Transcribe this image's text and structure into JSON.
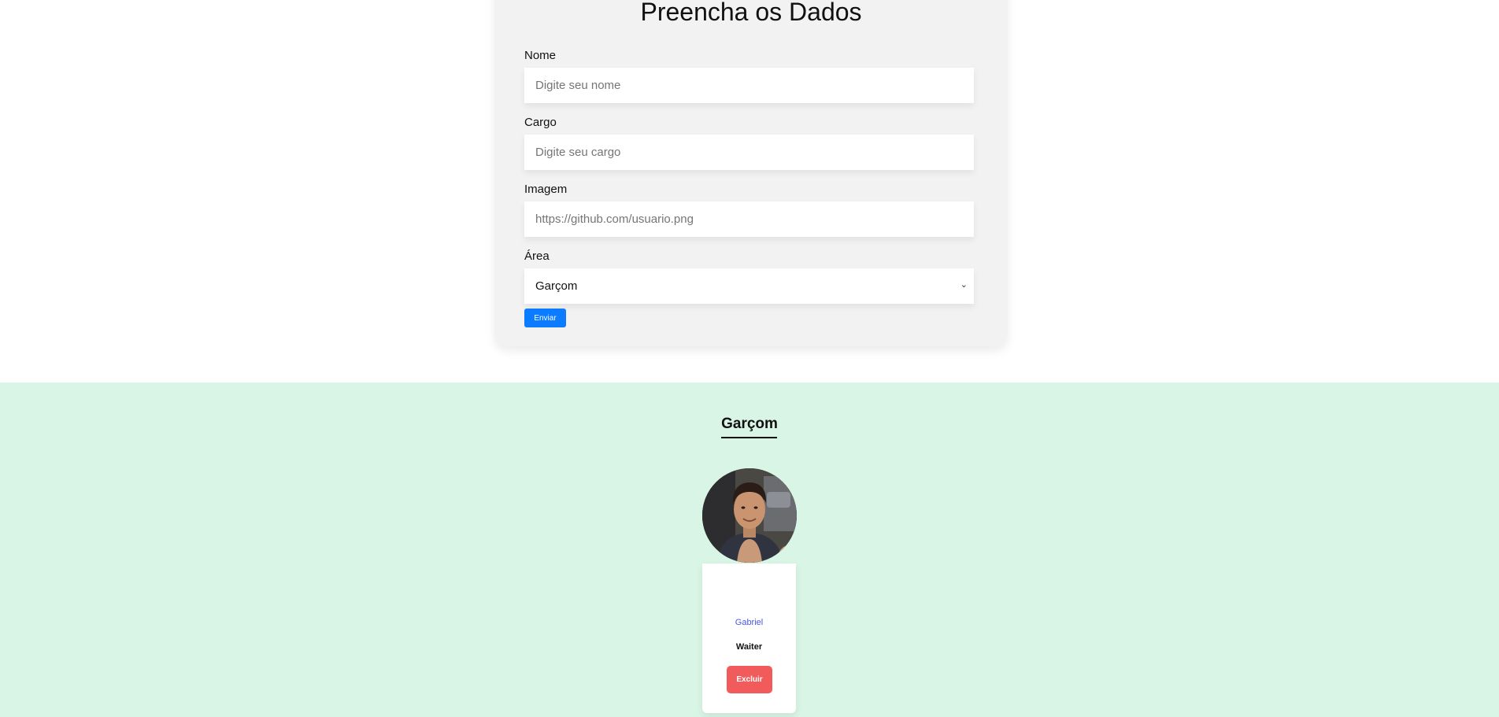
{
  "form": {
    "title": "Preencha os Dados",
    "fields": [
      {
        "label": "Nome",
        "placeholder": "Digite seu nome",
        "value": ""
      },
      {
        "label": "Cargo",
        "placeholder": "Digite seu cargo",
        "value": ""
      },
      {
        "label": "Imagem",
        "placeholder": "https://github.com/usuario.png",
        "value": ""
      }
    ],
    "area": {
      "label": "Área",
      "selected": "Garçom",
      "chevron": "⌄"
    },
    "submit_label": "Enviar",
    "submit_color": "#0b7bff"
  },
  "team_section": {
    "background": "#d9f5e6",
    "title": "Garçom",
    "members": [
      {
        "name": "Gabriel",
        "role": "Waiter",
        "delete_label": "Excluir",
        "avatar": "member-photo"
      }
    ]
  },
  "colors": {
    "name_text": "#4a56e2",
    "delete_button": "#f15b5b"
  }
}
